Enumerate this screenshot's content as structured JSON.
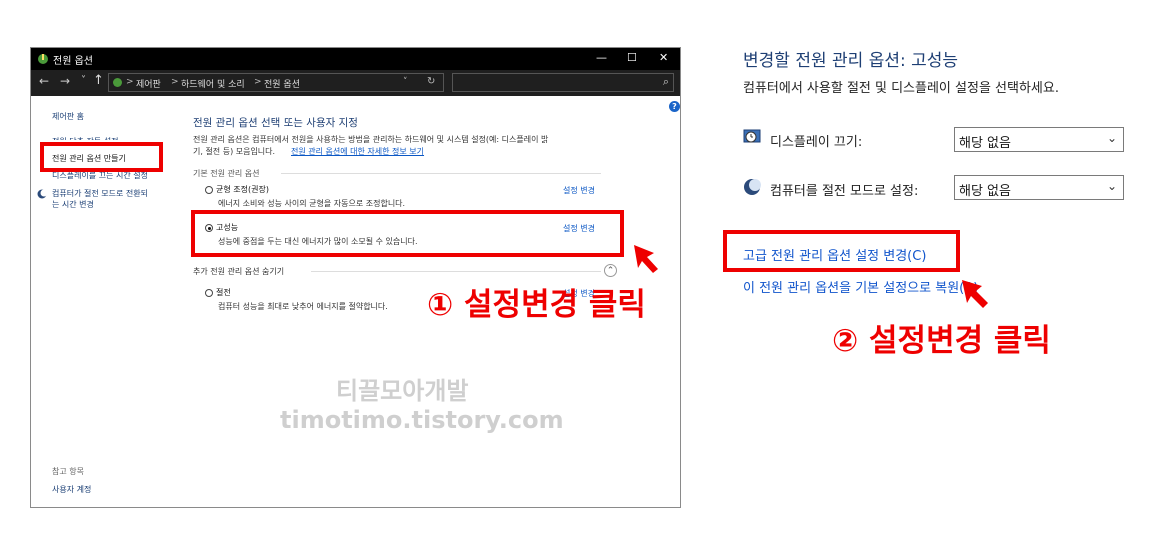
{
  "window": {
    "title": "전원 옵션",
    "minimize": "—",
    "maximize": "☐",
    "close": "✕",
    "nav_back": "←",
    "nav_forward": "→",
    "nav_down": "˅",
    "nav_up": "↑",
    "breadcrumb": [
      "제어판",
      "하드웨어 및 소리",
      "전원 옵션"
    ],
    "breadcrumb_sep": ">",
    "addr_dropdown": "˅",
    "refresh": "↻",
    "search_icon": "⌕",
    "help": "?"
  },
  "sidebar": {
    "home": "제어판 홈",
    "items": [
      "전원 단추 작동 설정",
      "전원 관리 옵션 만들기",
      "디스플레이를 끄는 시간 설정",
      "컴퓨터가 절전 모드로 전환되",
      "는 시간 변경"
    ],
    "see_also": "참고 항목",
    "user_accounts": "사용자 계정"
  },
  "main": {
    "title": "전원 관리 옵션 선택 또는 사용자 지정",
    "desc1": "전원 관리 옵션은 컴퓨터에서 전원을 사용하는 방법을 관리하는 하드웨어 및 시스템 설정(예: 디스플레이 밝",
    "desc2": "기, 절전 등) 모음입니다.",
    "desc_link": "전원 관리 옵션에 대한 자세한 정보 보기",
    "group_basic": "기본 전원 관리 옵션",
    "plans": [
      {
        "name": "균형 조정(권장)",
        "desc": "에너지 소비와 성능 사이의 균형을 자동으로 조정합니다.",
        "link": "설정 변경"
      },
      {
        "name": "고성능",
        "desc": "성능에 중점을 두는 대신 에너지가 많이 소모될 수 있습니다.",
        "link": "설정 변경"
      },
      {
        "name": "절전",
        "desc": "컴퓨터 성능을 최대로 낮추어 에너지를 절약합니다.",
        "link": "설정 변경"
      }
    ],
    "group_hidden": "추가 전원 관리 옵션 숨기기",
    "collapse_icon": "⌃"
  },
  "annotations": {
    "step1": "① 설정변경 클릭",
    "step2": "② 설정변경 클릭"
  },
  "watermark": {
    "line1": "티끌모아개발",
    "line2": "timotimo.tistory.com"
  },
  "right_panel": {
    "title": "변경할 전원 관리 옵션: 고성능",
    "subtitle": "컴퓨터에서 사용할 절전 및 디스플레이 설정을 선택하세요.",
    "display_off_label": "디스플레이 끄기:",
    "display_off_value": "해당 없음",
    "sleep_label": "컴퓨터를 절전 모드로 설정:",
    "sleep_value": "해당 없음",
    "advanced_link": "고급 전원 관리 옵션 설정 변경(C)",
    "restore_link": "이 전원 관리 옵션을 기본 설정으로 복원(R)",
    "chevron": "⌄"
  }
}
